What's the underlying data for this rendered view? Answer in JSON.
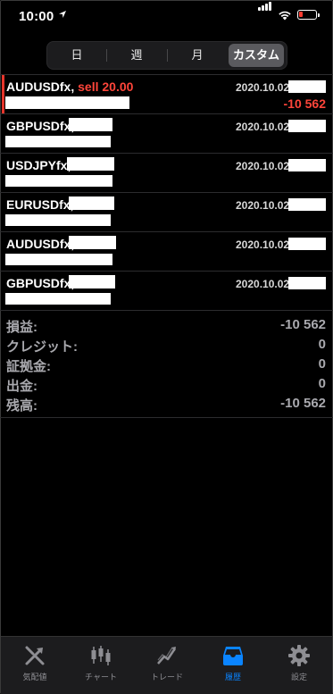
{
  "status_bar": {
    "time": "10:00"
  },
  "segments": [
    {
      "label": "日",
      "active": false
    },
    {
      "label": "週",
      "active": false
    },
    {
      "label": "月",
      "active": false
    },
    {
      "label": "カスタム",
      "active": true
    }
  ],
  "history": [
    {
      "symbol": "AUDUSDfx,",
      "deal": "sell 20.00",
      "date": "2020.10.02",
      "profit": "-10 562"
    },
    {
      "symbol": "GBPUSDfx,",
      "deal": "",
      "date": "2020.10.02",
      "profit": ""
    },
    {
      "symbol": "USDJPYfx,",
      "deal": "",
      "date": "2020.10.02",
      "profit": ""
    },
    {
      "symbol": "EURUSDfx,",
      "deal": "",
      "date": "2020.10.02",
      "profit": ""
    },
    {
      "symbol": "AUDUSDfx,",
      "deal": "",
      "date": "2020.10.02",
      "profit": ""
    },
    {
      "symbol": "GBPUSDfx,",
      "deal": "",
      "date": "2020.10.02",
      "profit": ""
    }
  ],
  "summary": [
    {
      "label": "損益:",
      "value": "-10 562"
    },
    {
      "label": "クレジット:",
      "value": "0"
    },
    {
      "label": "証拠金:",
      "value": "0"
    },
    {
      "label": "出金:",
      "value": "0"
    },
    {
      "label": "残高:",
      "value": "-10 562"
    }
  ],
  "tabbar": [
    {
      "label": "気配値",
      "icon": "quotes-icon",
      "active": false
    },
    {
      "label": "チャート",
      "icon": "chart-icon",
      "active": false
    },
    {
      "label": "トレード",
      "icon": "trade-icon",
      "active": false
    },
    {
      "label": "履歴",
      "icon": "history-icon",
      "active": true
    },
    {
      "label": "設定",
      "icon": "settings-icon",
      "active": false
    }
  ],
  "colors": {
    "loss": "#ff453a",
    "accent": "#0a84ff",
    "marker": "#e5352b"
  }
}
